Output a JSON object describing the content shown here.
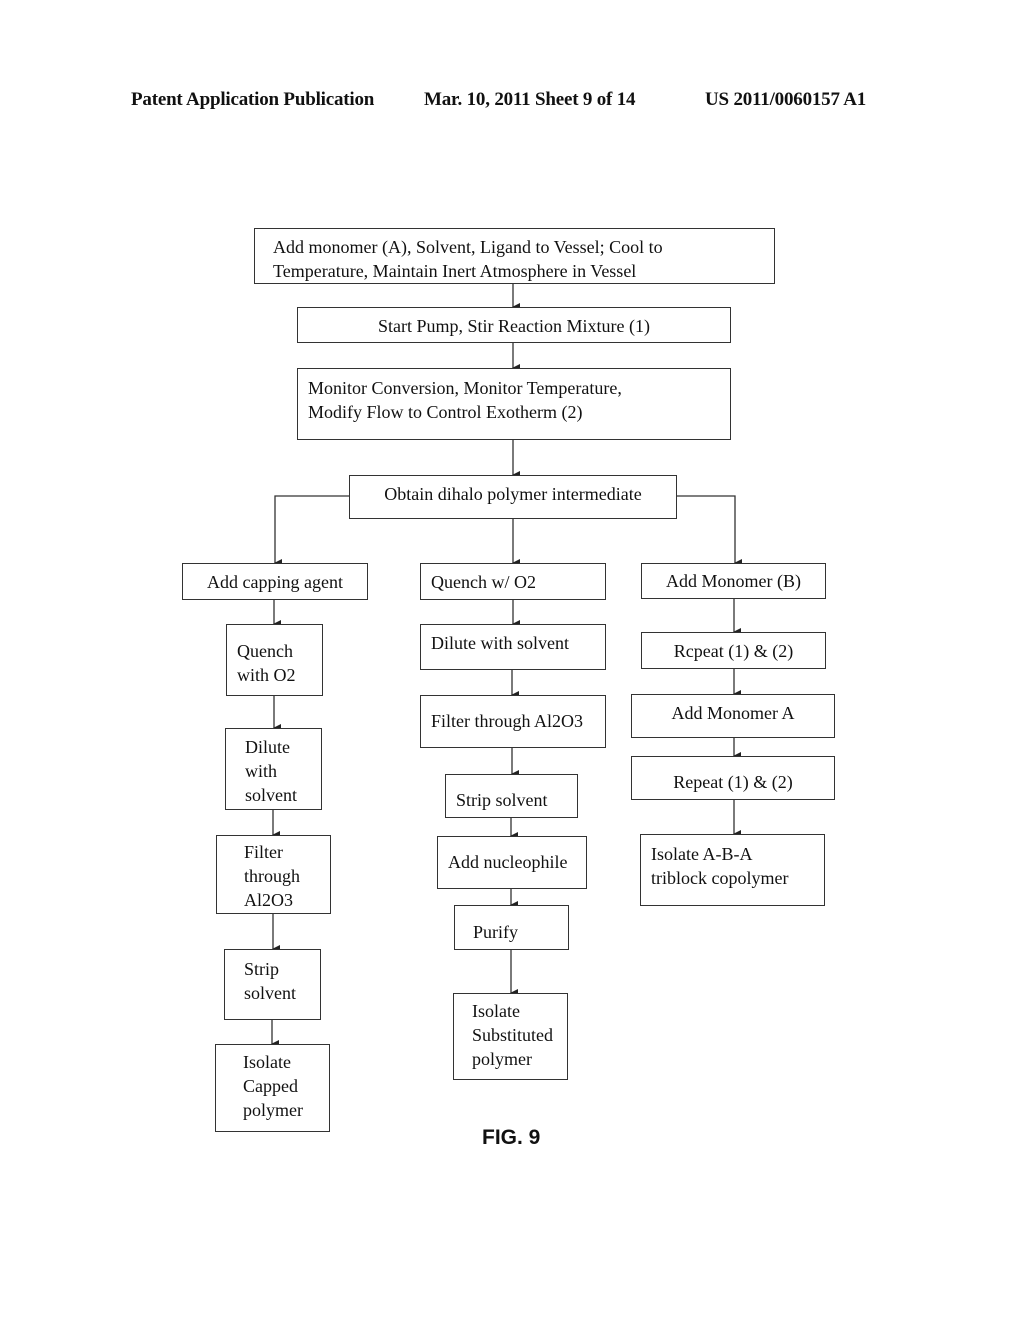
{
  "header": {
    "left": "Patent Application Publication",
    "middle": "Mar. 10, 2011  Sheet 9 of 14",
    "right": "US 2011/0060157 A1"
  },
  "figure_label": "FIG. 9",
  "flowchart": {
    "main": [
      {
        "id": "step-add-monomer",
        "text": "Add monomer (A), Solvent, Ligand to Vessel; Cool to\nTemperature, Maintain Inert Atmosphere in Vessel"
      },
      {
        "id": "step-start-pump",
        "text": "Start Pump, Stir Reaction Mixture (1)"
      },
      {
        "id": "step-monitor",
        "text": "Monitor Conversion, Monitor Temperature,\n Modify Flow to Control Exotherm (2)"
      },
      {
        "id": "step-obtain-intermediate",
        "text": "Obtain dihalo polymer intermediate"
      }
    ],
    "branch_left": [
      {
        "text": "Add capping agent"
      },
      {
        "text": "Quench\nwith O2"
      },
      {
        "text": "Dilute\nwith\nsolvent"
      },
      {
        "text": "Filter\nthrough\nAl2O3"
      },
      {
        "text": "Strip\nsolvent"
      },
      {
        "text": "Isolate\nCapped\npolymer"
      }
    ],
    "branch_middle": [
      {
        "text": "Quench w/ O2"
      },
      {
        "text": "Dilute with solvent"
      },
      {
        "text": "Filter through Al2O3"
      },
      {
        "text": "Strip solvent"
      },
      {
        "text": "Add nucleophile"
      },
      {
        "text": "Purify"
      },
      {
        "text": "Isolate\nSubstituted\npolymer"
      }
    ],
    "branch_right": [
      {
        "text": "Add Monomer (B)"
      },
      {
        "text": "Rcpeat (1) & (2)"
      },
      {
        "text": "Add Monomer A"
      },
      {
        "text": "Repeat (1) & (2)"
      },
      {
        "text": "Isolate A-B-A\ntriblock copolymer"
      }
    ]
  }
}
